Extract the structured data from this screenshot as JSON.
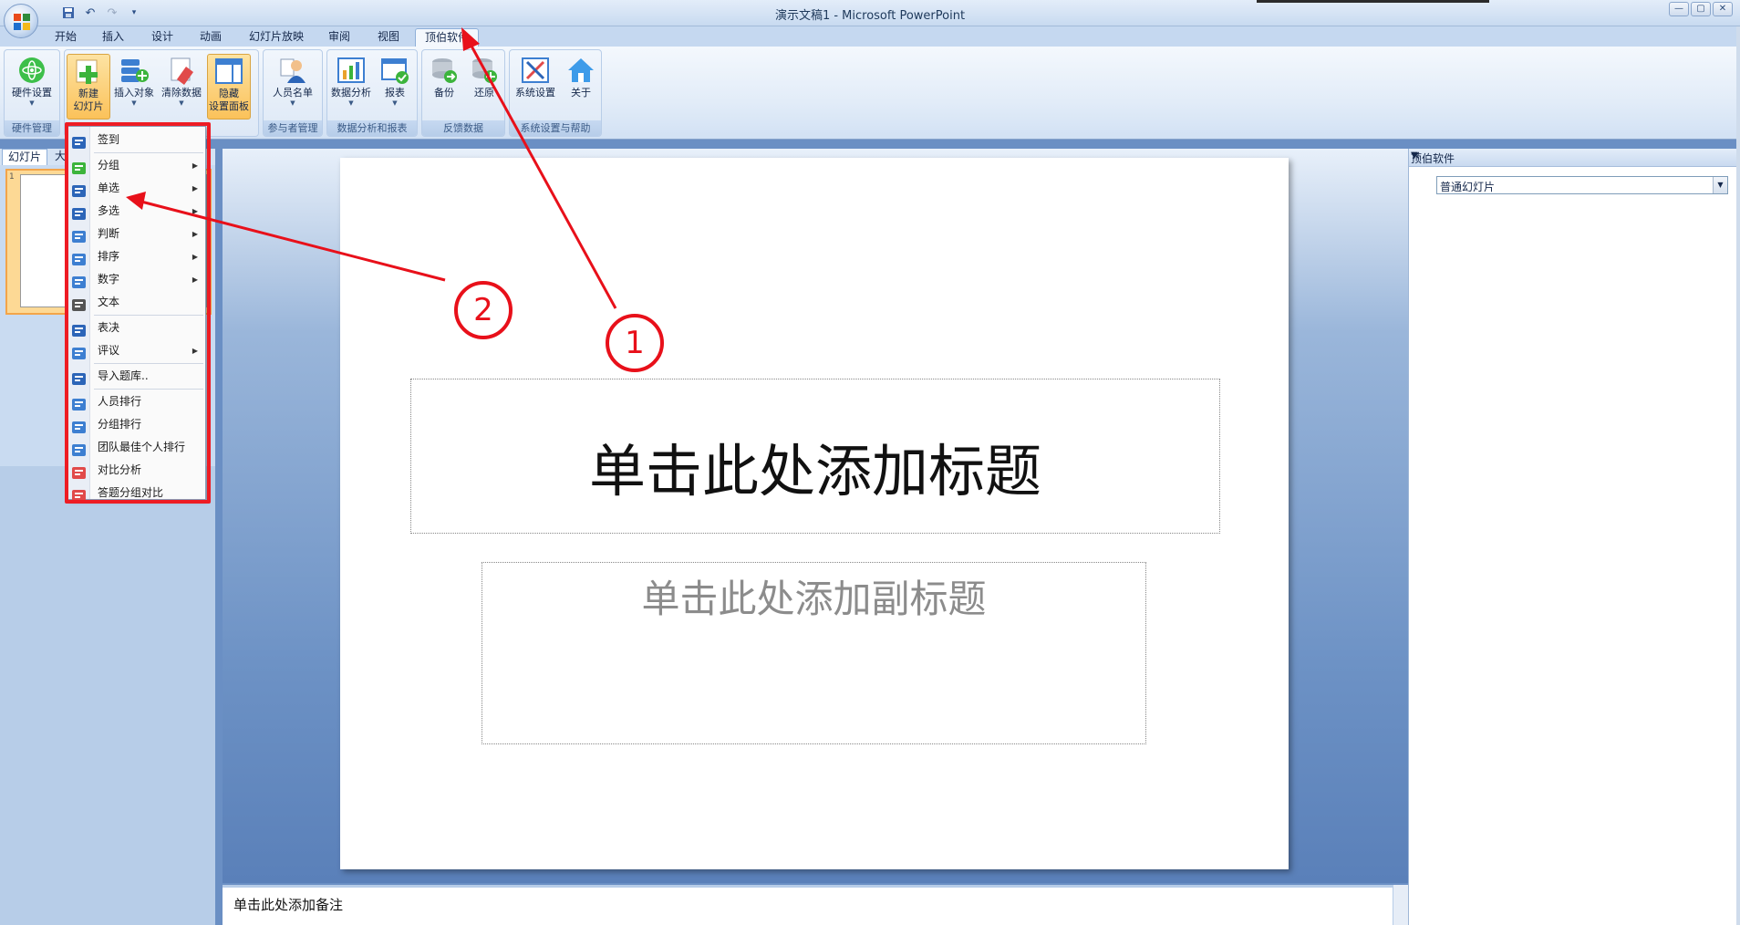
{
  "window": {
    "title": "演示文稿1 - Microsoft PowerPoint",
    "minimize": "—",
    "restore": "▢",
    "close": "✕"
  },
  "tabs": [
    "开始",
    "插入",
    "设计",
    "动画",
    "幻灯片放映",
    "审阅",
    "视图",
    "顶伯软件"
  ],
  "active_tab": "顶伯软件",
  "ribbon": {
    "hw_settings": "硬件设置",
    "new_slide_1": "新建",
    "new_slide_2": "幻灯片",
    "insert_object": "插入对象",
    "clear_data": "清除数据",
    "hide_panel_1": "隐藏",
    "hide_panel_2": "设置面板",
    "participants": "人员名单",
    "data_analysis": "数据分析",
    "report": "报表",
    "backup": "备份",
    "restore": "还原",
    "sys_settings": "系统设置",
    "about": "关于",
    "groups": {
      "hardware": "硬件管理",
      "participant_mgmt": "参与者管理",
      "analysis": "数据分析和报表",
      "feedback": "反馈数据",
      "system": "系统设置与帮助"
    }
  },
  "left_pane": {
    "tab_slides": "幻灯片",
    "tab_outline": "大",
    "slide_number": "1"
  },
  "menu": {
    "items": [
      {
        "label": "签到",
        "submenu": false
      },
      {
        "label": "分组",
        "submenu": true
      },
      {
        "label": "单选",
        "submenu": true
      },
      {
        "label": "多选",
        "submenu": true
      },
      {
        "label": "判断",
        "submenu": true
      },
      {
        "label": "排序",
        "submenu": true
      },
      {
        "label": "数字",
        "submenu": true
      },
      {
        "label": "文本",
        "submenu": false
      },
      {
        "label": "表决",
        "submenu": false
      },
      {
        "label": "评议",
        "submenu": true
      },
      {
        "label": "导入题库..",
        "submenu": false
      },
      {
        "label": "人员排行",
        "submenu": false
      },
      {
        "label": "分组排行",
        "submenu": false
      },
      {
        "label": "团队最佳个人排行",
        "submenu": false
      },
      {
        "label": "对比分析",
        "submenu": false
      },
      {
        "label": "答题分组对比",
        "submenu": false
      }
    ],
    "arrow": "▶"
  },
  "slide": {
    "title_placeholder": "单击此处添加标题",
    "subtitle_placeholder": "单击此处添加副标题"
  },
  "notes": {
    "placeholder": "单击此处添加备注"
  },
  "task_pane": {
    "title": "顶伯软件",
    "select_value": "普通幻灯片",
    "dropdown_arrow": "▼",
    "close": "✕"
  },
  "annotations": {
    "circle_1": "1",
    "circle_2": "2"
  },
  "colors": {
    "highlight_red": "#ee1c24",
    "ribbon_hot": "#fbc25a",
    "office_blue": "#6a8fc4"
  }
}
